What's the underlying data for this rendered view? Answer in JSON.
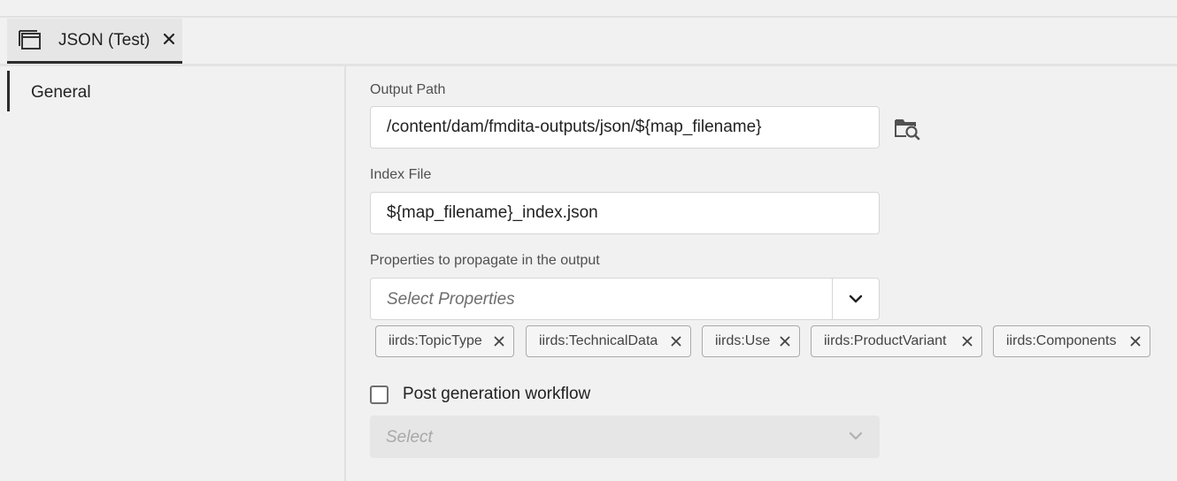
{
  "tab": {
    "label": "JSON (Test)"
  },
  "sidebar": {
    "items": [
      {
        "label": "General"
      }
    ]
  },
  "form": {
    "output_path": {
      "label": "Output Path",
      "value": "/content/dam/fmdita-outputs/json/${map_filename}"
    },
    "index_file": {
      "label": "Index File",
      "value": "${map_filename}_index.json"
    },
    "properties": {
      "label": "Properties to propagate in the output",
      "placeholder": "Select Properties",
      "tags": [
        "iirds:TopicType",
        "iirds:TechnicalData",
        "iirds:Use",
        "iirds:ProductVariant",
        "iirds:Components"
      ]
    },
    "post_generation": {
      "label": "Post generation workflow",
      "checked": false
    },
    "workflow_select": {
      "placeholder": "Select",
      "disabled": true
    }
  },
  "icons": {
    "tab": "window-icon",
    "close": "close-icon",
    "browse": "folder-search-icon",
    "dropdown": "chevron-down-icon",
    "tag_remove": "close-icon"
  },
  "colors": {
    "background": "#f1f1f1",
    "input_background": "#ffffff",
    "active_indicator": "#2c2c2c",
    "disabled_background": "#e6e6e6"
  }
}
